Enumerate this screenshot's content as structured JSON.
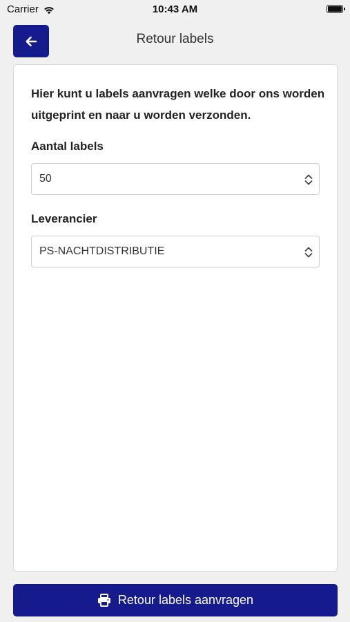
{
  "status_bar": {
    "carrier": "Carrier",
    "time": "10:43 AM",
    "icons": [
      "wifi-icon",
      "battery-icon"
    ]
  },
  "header": {
    "title": "Retour labels",
    "back_icon": "arrow-left-icon"
  },
  "card": {
    "intro": "Hier kunt u labels aanvragen welke door ons worden uitgeprint en naar u worden verzonden.",
    "fields": [
      {
        "label": "Aantal labels",
        "value": "50"
      },
      {
        "label": "Leverancier",
        "value": "PS-NACHTDISTRIBUTIE"
      }
    ]
  },
  "action": {
    "label": "Retour labels aanvragen",
    "icon": "printer-icon"
  },
  "colors": {
    "accent": "#151a8c",
    "background": "#f0f0f0",
    "card": "#ffffff"
  }
}
